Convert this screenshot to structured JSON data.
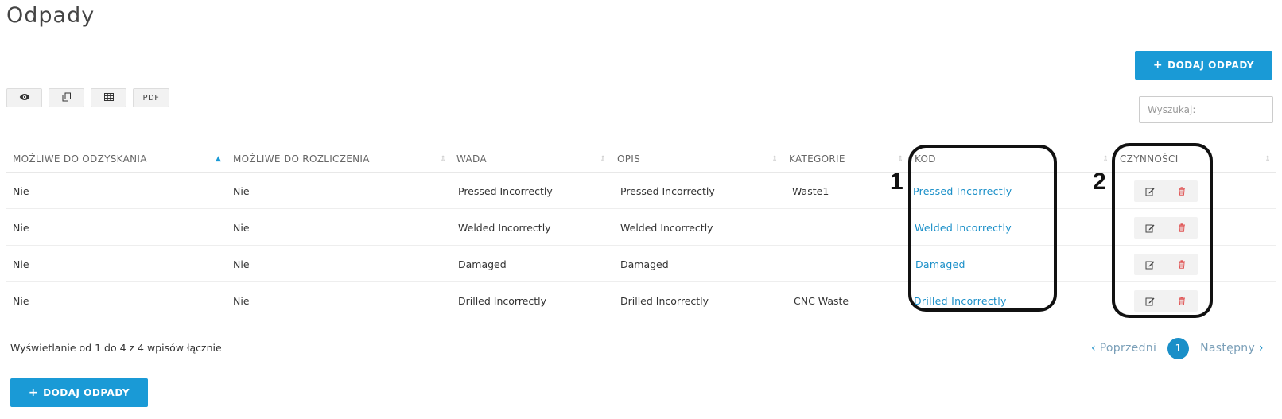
{
  "page": {
    "title": "Odpady"
  },
  "toolbar": {
    "add_label": "DODAJ ODPADY",
    "pdf_label": "PDF",
    "view_icon": "eye-icon",
    "copy_icon": "copy-icon",
    "excel_icon": "table-icon"
  },
  "search": {
    "placeholder": "Wyszukaj:"
  },
  "table": {
    "headers": [
      "MOŻLIWE DO ODZYSKANIA",
      "MOŻLIWE DO ROZLICZENIA",
      "WADA",
      "OPIS",
      "KATEGORIE",
      "KOD",
      "CZYNNOŚCI"
    ],
    "rows": [
      {
        "recoverable": "Nie",
        "settleable": "Nie",
        "defect": "Pressed Incorrectly",
        "description": "Pressed Incorrectly",
        "category": "Waste1",
        "code": "Pressed Incorrectly"
      },
      {
        "recoverable": "Nie",
        "settleable": "Nie",
        "defect": "Welded Incorrectly",
        "description": "Welded Incorrectly",
        "category": "",
        "code": "Welded Incorrectly"
      },
      {
        "recoverable": "Nie",
        "settleable": "Nie",
        "defect": "Damaged",
        "description": "Damaged",
        "category": "",
        "code": "Damaged"
      },
      {
        "recoverable": "Nie",
        "settleable": "Nie",
        "defect": "Drilled Incorrectly",
        "description": "Drilled Incorrectly",
        "category": "CNC Waste",
        "code": "Drilled Incorrectly"
      }
    ]
  },
  "annotations": {
    "first": "1",
    "second": "2"
  },
  "footer": {
    "info": "Wyświetlanie od 1 do 4 z 4 wpisów łącznie",
    "prev": "Poprzedni",
    "current_page": "1",
    "next": "Następny"
  },
  "colors": {
    "accent": "#1a9ad6",
    "link": "#1a8fc8",
    "delete": "#e05555"
  }
}
